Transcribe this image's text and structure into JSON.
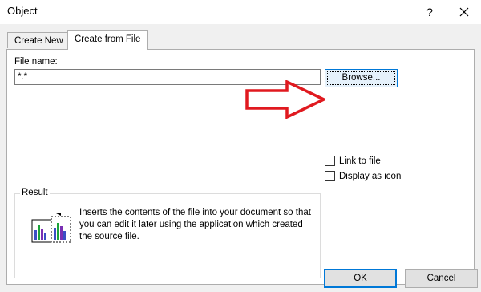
{
  "window": {
    "title": "Object"
  },
  "tabs": [
    {
      "label": "Create New",
      "active": false
    },
    {
      "label": "Create from File",
      "active": true
    }
  ],
  "file_name": {
    "label": "File name:",
    "value": "*.*"
  },
  "browse": {
    "label": "Browse..."
  },
  "options": {
    "link_to_file": {
      "label": "Link to file",
      "checked": false
    },
    "display_as_icon": {
      "label": "Display as icon",
      "checked": false
    }
  },
  "result": {
    "label": "Result",
    "text": "Inserts the contents of the file into your document so that you can edit it later using the application which created the source file."
  },
  "footer": {
    "ok_label": "OK",
    "cancel_label": "Cancel"
  },
  "colors": {
    "accent": "#0078d7",
    "arrow": "#e0191f",
    "dialog_bg": "#f0f0f0"
  }
}
